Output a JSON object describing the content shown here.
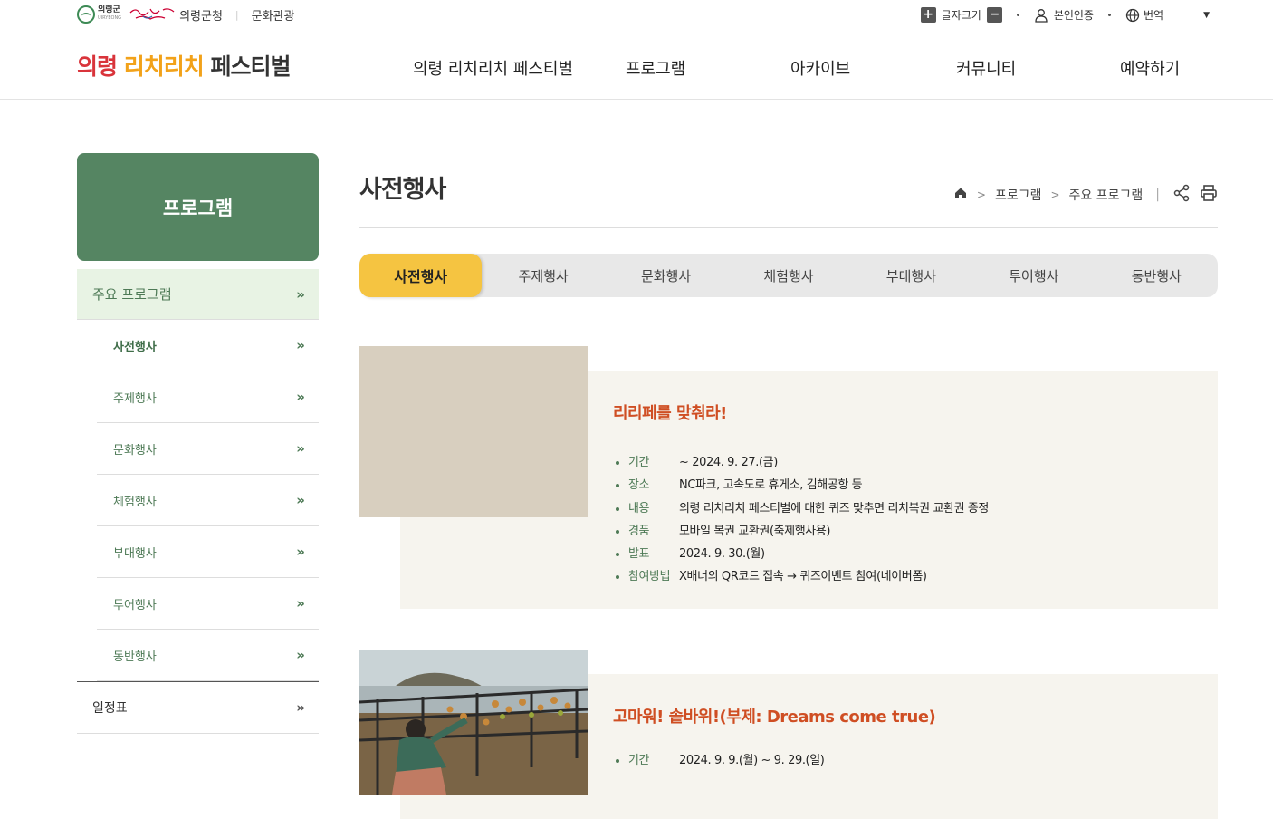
{
  "util": {
    "gov_logo_name": "의령군",
    "gov_logo_en": "UIRYEONG",
    "slogan": "의령군청",
    "culture_link": "문화관광",
    "font_size_label": "글자크기",
    "font_plus": "+",
    "font_minus": "−",
    "auth_label": "본인인증",
    "translate_label": "번역",
    "dropdown_caret": "▼"
  },
  "header": {
    "brand_part1": "의령",
    "brand_part2": "리치리치",
    "brand_part3": "페스티벌",
    "nav": [
      "의령 리치리치 페스티벌",
      "프로그램",
      "아카이브",
      "커뮤니티",
      "예약하기"
    ]
  },
  "lnb": {
    "title": "프로그램",
    "main_item": "주요 프로그램",
    "sub_items": [
      "사전행사",
      "주제행사",
      "문화행사",
      "체험행사",
      "부대행사",
      "투어행사",
      "동반행사"
    ],
    "schedule_item": "일정표",
    "chevron": "»"
  },
  "content": {
    "page_title": "사전행사",
    "breadcrumb": [
      "프로그램",
      "주요 프로그램"
    ],
    "breadcrumb_sep": ">",
    "tabs": [
      "사전행사",
      "주제행사",
      "문화행사",
      "체험행사",
      "부대행사",
      "투어행사",
      "동반행사"
    ],
    "active_tab": "사전행사"
  },
  "events": [
    {
      "title": "리리페를 맞춰라!",
      "details": [
        {
          "label": "기간",
          "value": "~ 2024. 9. 27.(금)"
        },
        {
          "label": "장소",
          "value": "NC파크, 고속도로 휴게소, 김해공항 등"
        },
        {
          "label": "내용",
          "value": "의령 리치리치 페스티벌에 대한 퀴즈 맞추면 리치복권 교환권 증정"
        },
        {
          "label": "경품",
          "value": "모바일 복권 교환권(축제행사용)"
        },
        {
          "label": "발표",
          "value": "2024. 9. 30.(월)"
        },
        {
          "label": "참여방법",
          "value": "X배너의 QR코드 접속 → 퀴즈이벤트 참여(네이버폼)"
        }
      ]
    },
    {
      "title": "고마워! 솥바위!(부제: Dreams come true)",
      "details": [
        {
          "label": "기간",
          "value": "2024. 9. 9.(월) ~ 9. 29.(일)"
        }
      ]
    }
  ],
  "colors": {
    "brand_red": "#d9343b",
    "brand_orange": "#f2a21a",
    "lnb_green": "#558562",
    "tab_active": "#f5c441",
    "event_title": "#cf4e23"
  }
}
